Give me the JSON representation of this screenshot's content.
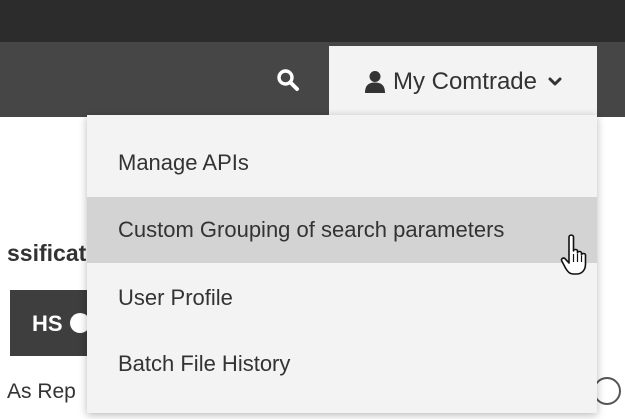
{
  "header": {
    "search_icon": "search-icon",
    "account": {
      "icon": "user-icon",
      "label": "My Comtrade",
      "chevron_icon": "chevron-down-icon"
    }
  },
  "background": {
    "classification_label": "ssificat",
    "hs_tab_label": "HS",
    "as_reported_label": "As Rep"
  },
  "menu": {
    "items": [
      {
        "label": "Manage APIs"
      },
      {
        "label": "Custom Grouping of search parameters"
      },
      {
        "label": "User Profile"
      },
      {
        "label": "Batch File History"
      }
    ],
    "hovered_index": 1
  },
  "colors": {
    "topbar": "#464646",
    "topbar_dark": "#2c2c2c",
    "menu_bg": "#f3f3f3",
    "menu_hover": "#d3d3d3",
    "text": "#333333"
  }
}
